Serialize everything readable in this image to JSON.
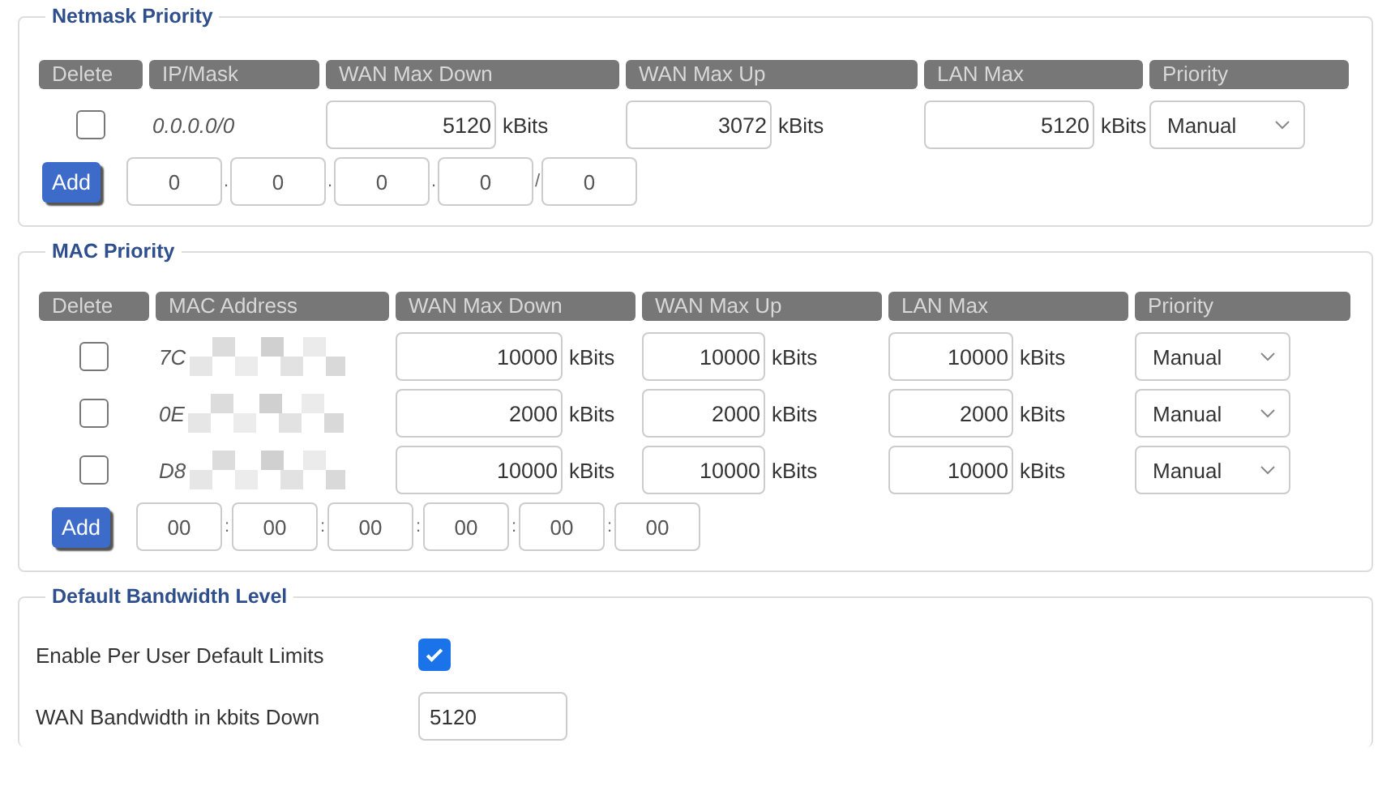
{
  "netmask_priority": {
    "title": "Netmask Priority",
    "columns": [
      "Delete",
      "IP/Mask",
      "WAN Max Down",
      "WAN Max Up",
      "LAN Max",
      "Priority"
    ],
    "rows": [
      {
        "checked": false,
        "address": "0.0.0.0/0",
        "wan_down": {
          "value": "5120",
          "unit": "kBits"
        },
        "wan_up": {
          "value": "3072",
          "unit": "kBits"
        },
        "lan_max": {
          "value": "5120",
          "unit": "kBits"
        },
        "priority": "Manual"
      }
    ],
    "add_button": "Add",
    "add_fields": [
      {
        "value": "0",
        "separator": "."
      },
      {
        "value": "0",
        "separator": "."
      },
      {
        "value": "0",
        "separator": "."
      },
      {
        "value": "0",
        "separator": "/"
      },
      {
        "value": "0"
      }
    ]
  },
  "mac_priority": {
    "title": "MAC Priority",
    "columns": [
      "Delete",
      "MAC Address",
      "WAN Max Down",
      "WAN Max Up",
      "LAN Max",
      "Priority"
    ],
    "rows": [
      {
        "checked": false,
        "address": "7C",
        "wan_down": {
          "value": "10000",
          "unit": "kBits"
        },
        "wan_up": {
          "value": "10000",
          "unit": "kBits"
        },
        "lan_max": {
          "value": "10000",
          "unit": "kBits"
        },
        "priority": "Manual"
      },
      {
        "checked": false,
        "address": "0E",
        "wan_down": {
          "value": "2000",
          "unit": "kBits"
        },
        "wan_up": {
          "value": "2000",
          "unit": "kBits"
        },
        "lan_max": {
          "value": "2000",
          "unit": "kBits"
        },
        "priority": "Manual"
      },
      {
        "checked": false,
        "address": "D8",
        "wan_down": {
          "value": "10000",
          "unit": "kBits"
        },
        "wan_up": {
          "value": "10000",
          "unit": "kBits"
        },
        "lan_max": {
          "value": "10000",
          "unit": "kBits"
        },
        "priority": "Manual"
      }
    ],
    "add_button": "Add",
    "add_fields": [
      {
        "value": "00",
        "separator": ":"
      },
      {
        "value": "00",
        "separator": ":"
      },
      {
        "value": "00",
        "separator": ":"
      },
      {
        "value": "00",
        "separator": ":"
      },
      {
        "value": "00",
        "separator": ":"
      },
      {
        "value": "00"
      }
    ]
  },
  "default_bandwidth": {
    "title": "Default Bandwidth Level",
    "settings": [
      {
        "kind": "checkbox",
        "label": "Enable Per User Default Limits",
        "checked": true
      },
      {
        "kind": "input",
        "label": "WAN Bandwidth in kbits Down",
        "value": "5120"
      }
    ]
  }
}
